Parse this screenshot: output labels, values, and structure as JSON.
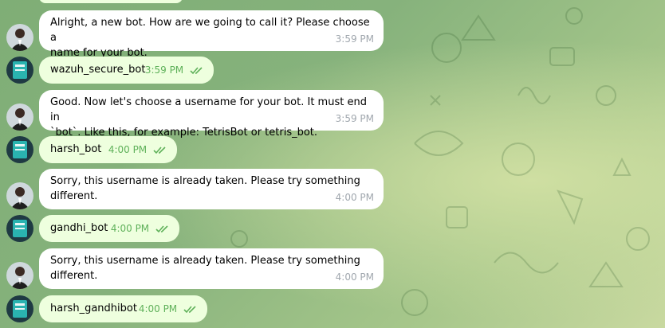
{
  "chat": {
    "messages": [
      {
        "sender": "bot",
        "text_lines": [
          "Alright, a new bot. How are we going to call it? Please choose a",
          "name for your bot."
        ],
        "time": "3:59 PM"
      },
      {
        "sender": "user",
        "text_lines": [
          "wazuh_secure_bot"
        ],
        "time": "3:59 PM",
        "read": true
      },
      {
        "sender": "bot",
        "text_lines": [
          "Good. Now let's choose a username for your bot. It must end in",
          "`bot`. Like this, for example: TetrisBot or tetris_bot."
        ],
        "time": "3:59 PM"
      },
      {
        "sender": "user",
        "text_lines": [
          "harsh_bot"
        ],
        "time": "4:00 PM",
        "read": true
      },
      {
        "sender": "bot",
        "text_lines": [
          "Sorry, this username is already taken. Please try something",
          "different."
        ],
        "time": "4:00 PM"
      },
      {
        "sender": "user",
        "text_lines": [
          "gandhi_bot"
        ],
        "time": "4:00 PM",
        "read": true
      },
      {
        "sender": "bot",
        "text_lines": [
          "Sorry, this username is already taken. Please try something",
          "different."
        ],
        "time": "4:00 PM"
      },
      {
        "sender": "user",
        "text_lines": [
          "harsh_gandhibot"
        ],
        "time": "4:00 PM",
        "read": true
      }
    ]
  },
  "colors": {
    "incoming_bubble": "#ffffff",
    "outgoing_bubble": "#eeffde",
    "outgoing_time": "#5fb15a",
    "incoming_time": "#a0a7ae"
  },
  "icons": {
    "bot_avatar": "man-in-suit-avatar-icon",
    "user_avatar": "teal-book-avatar-icon",
    "read_receipt": "double-check-icon"
  }
}
